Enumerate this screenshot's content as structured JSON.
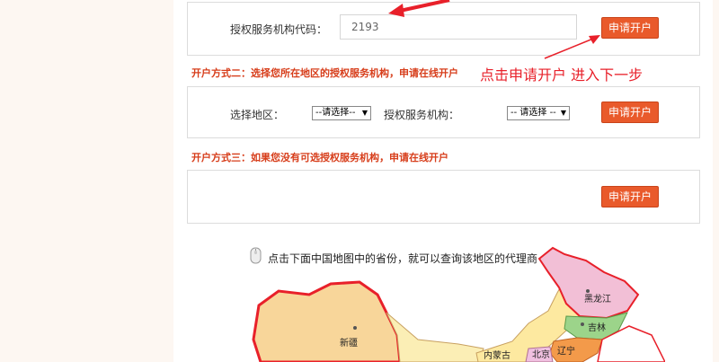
{
  "section1": {
    "code_label": "授权服务机构代码：",
    "code_value": "2193",
    "apply_button": "申请开户"
  },
  "annotation_text": "点击申请开户 进入下一步",
  "section2": {
    "title": "开户方式二：选择您所在地区的授权服务机构，申请在线开户",
    "region_label": "选择地区：",
    "region_select": "--请选择--",
    "agency_label": "授权服务机构：",
    "agency_select": "-- 请选择 --",
    "apply_button": "申请开户"
  },
  "section3": {
    "title": "开户方式三：如果您没有可选授权服务机构，申请在线开户",
    "apply_button": "申请开户"
  },
  "map": {
    "hint": "点击下面中国地图中的省份，就可以查询该地区的代理商",
    "provinces": {
      "xinjiang": "新疆",
      "heilongjiang": "黑龙江",
      "jilin": "吉林",
      "liaoning": "辽宁",
      "neimenggu": "内蒙古",
      "beijing": "北京"
    }
  },
  "colors": {
    "accent": "#e95a2b",
    "section_title": "#d73d1a",
    "annotation": "#e8202a",
    "border_map": "#e8202a"
  }
}
